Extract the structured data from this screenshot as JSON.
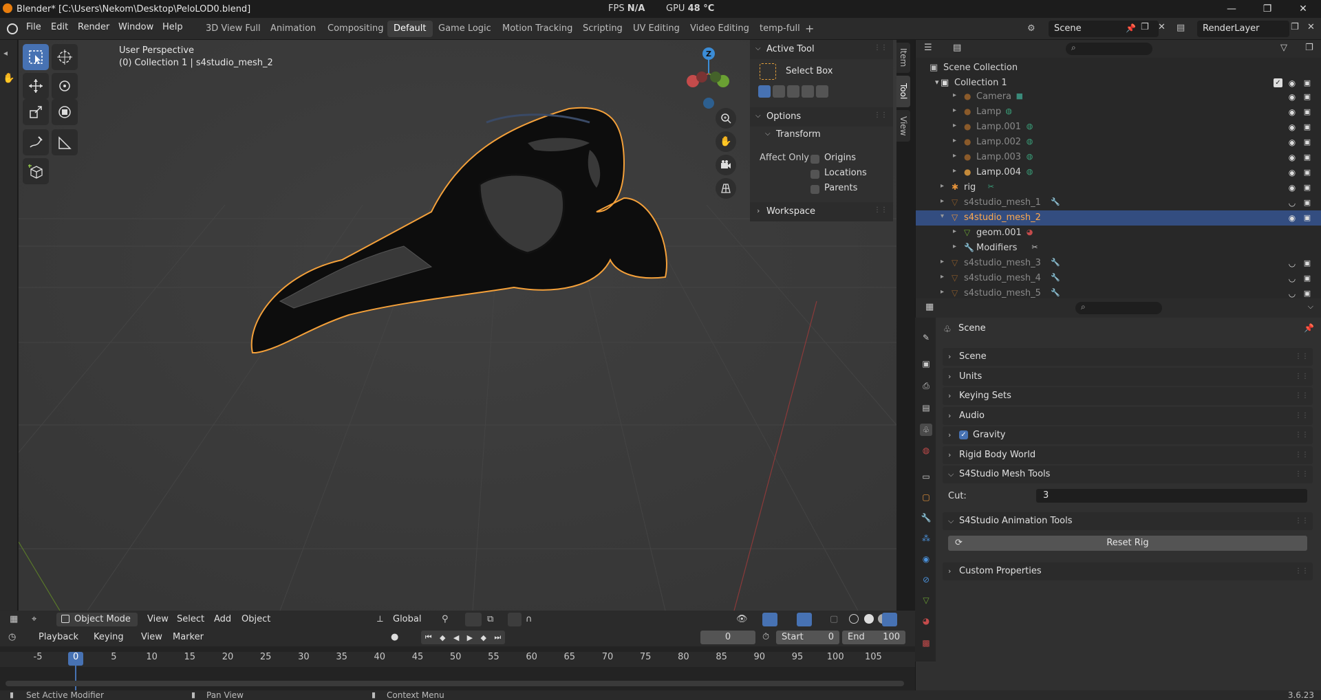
{
  "window": {
    "title": "Blender* [C:\\Users\\Nekom\\Desktop\\PeloLOD0.blend]",
    "controls": [
      "—",
      "❐",
      "✕"
    ]
  },
  "stats": {
    "fps_label": "FPS",
    "fps_value": "N/A",
    "gpu_label": "GPU",
    "gpu_value": "48 °C"
  },
  "menu": {
    "file": "File",
    "edit": "Edit",
    "render": "Render",
    "window": "Window",
    "help": "Help"
  },
  "workspaces": [
    "3D View Full",
    "Animation",
    "Compositing",
    "Default",
    "Game Logic",
    "Motion Tracking",
    "Scripting",
    "UV Editing",
    "Video Editing",
    "temp-full"
  ],
  "active_workspace": "Default",
  "scene_selector": "Scene",
  "renderlayer_selector": "RenderLayer",
  "viewport": {
    "perspective": "User Perspective",
    "collection_info": "(0) Collection 1 | s4studio_mesh_2",
    "gizmo_axis": "Z"
  },
  "npanel": {
    "active_tool_title": "Active Tool",
    "tool_name": "Select Box",
    "options_title": "Options",
    "transform_title": "Transform",
    "affect_only": "Affect Only",
    "opt_origins": "Origins",
    "opt_locations": "Locations",
    "opt_parents": "Parents",
    "workspace_title": "Workspace",
    "tabs": [
      "Item",
      "Tool",
      "View"
    ]
  },
  "viewport_header": {
    "mode": "Object Mode",
    "view": "View",
    "select": "Select",
    "add": "Add",
    "object": "Object",
    "transform": "Global"
  },
  "timeline": {
    "playback": "Playback",
    "keying": "Keying",
    "view": "View",
    "marker": "Marker",
    "current_frame": "0",
    "start_label": "Start",
    "start": "0",
    "end_label": "End",
    "end": "100",
    "ticks": [
      "-5",
      "0",
      "5",
      "10",
      "15",
      "20",
      "25",
      "30",
      "35",
      "40",
      "45",
      "50",
      "55",
      "60",
      "65",
      "70",
      "75",
      "80",
      "85",
      "90",
      "95",
      "100",
      "105"
    ]
  },
  "statusbar": {
    "left": "Set Active Modifier",
    "middle": "Pan View",
    "right": "Context Menu",
    "version": "3.6.23"
  },
  "outliner": {
    "root": "Scene Collection",
    "collection": "Collection 1",
    "rows": [
      {
        "name": "Camera",
        "dim": true
      },
      {
        "name": "Lamp",
        "dim": true
      },
      {
        "name": "Lamp.001",
        "dim": true
      },
      {
        "name": "Lamp.002",
        "dim": true
      },
      {
        "name": "Lamp.003",
        "dim": true
      },
      {
        "name": "Lamp.004",
        "dim": false
      },
      {
        "name": "rig",
        "dim": false
      },
      {
        "name": "s4studio_mesh_1",
        "dim": true
      },
      {
        "name": "s4studio_mesh_2",
        "dim": false
      },
      {
        "name": "geom.001",
        "dim": false
      },
      {
        "name": "Modifiers",
        "dim": false
      },
      {
        "name": "s4studio_mesh_3",
        "dim": true
      },
      {
        "name": "s4studio_mesh_4",
        "dim": true
      },
      {
        "name": "s4studio_mesh_5",
        "dim": true
      }
    ]
  },
  "properties": {
    "context": "Scene",
    "sections": [
      "Scene",
      "Units",
      "Keying Sets",
      "Audio",
      "Gravity",
      "Rigid Body World",
      "S4Studio Mesh Tools",
      "S4Studio Animation Tools",
      "Custom Properties"
    ],
    "cut_label": "Cut:",
    "cut_value": "3",
    "reset_rig": "Reset Rig"
  },
  "colors": {
    "accent": "#4772b3",
    "selection": "#334d80",
    "outline": "#f5a13a",
    "header": "#2b2b2b"
  }
}
